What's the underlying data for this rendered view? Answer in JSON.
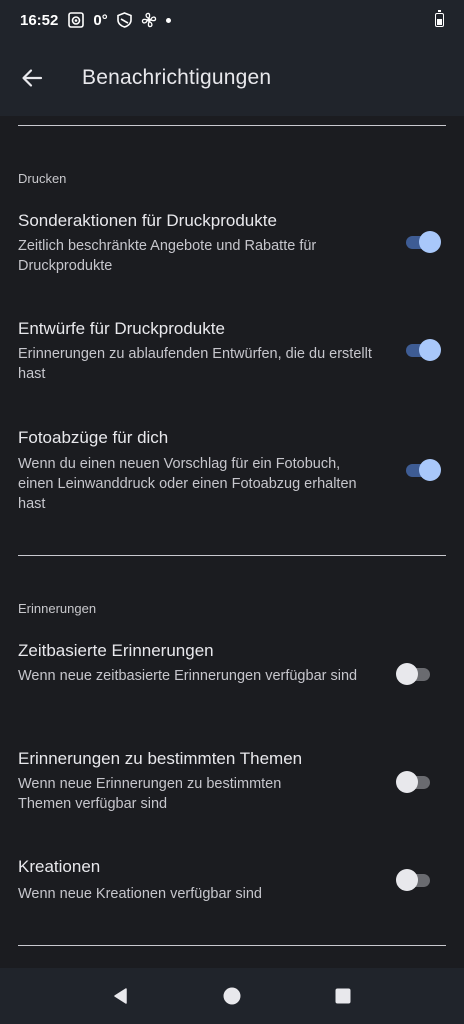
{
  "status_bar": {
    "time": "16:52",
    "temperature": "0°",
    "icons": [
      "camera-icon",
      "shield-icon",
      "fan-icon",
      "dot-icon",
      "battery-icon"
    ]
  },
  "app_bar": {
    "title": "Benachrichtigungen",
    "back_icon": "arrow-left-icon"
  },
  "sections": [
    {
      "header": "Drucken",
      "items": [
        {
          "title": "Sonderaktionen für Druckprodukte",
          "description": "Zeitlich beschränkte Angebote und Rabatte für Druckprodukte",
          "enabled": true
        },
        {
          "title": "Entwürfe für Druckprodukte",
          "description": "Erinnerungen zu ablaufenden Entwürfen, die du erstellt hast",
          "enabled": true
        },
        {
          "title": "Fotoabzüge für dich",
          "description": "Wenn du einen neuen Vorschlag für ein Fotobuch, einen Leinwanddruck oder einen Fotoabzug erhalten hast",
          "enabled": true
        }
      ]
    },
    {
      "header": "Erinnerungen",
      "items": [
        {
          "title": "Zeitbasierte Erinnerungen",
          "description": "Wenn neue zeitbasierte Erinnerungen verfügbar sind",
          "enabled": false
        },
        {
          "title": "Erinnerungen zu bestimmten Themen",
          "description": "Wenn neue Erinnerungen zu bestimmten Themen verfügbar sind",
          "enabled": false
        },
        {
          "title": "Kreationen",
          "description": "Wenn neue Kreationen verfügbar sind",
          "enabled": false
        }
      ]
    }
  ],
  "nav_bar": {
    "icons": [
      "back-triangle-icon",
      "home-circle-icon",
      "recents-square-icon"
    ]
  },
  "colors": {
    "background": "#1b1c20",
    "bars": "#20242b",
    "toggle_on_track": "#3e5c94",
    "toggle_on_thumb": "#a9c8fa",
    "toggle_off_track": "#6a6b70",
    "toggle_off_thumb": "#e8e8ec"
  }
}
